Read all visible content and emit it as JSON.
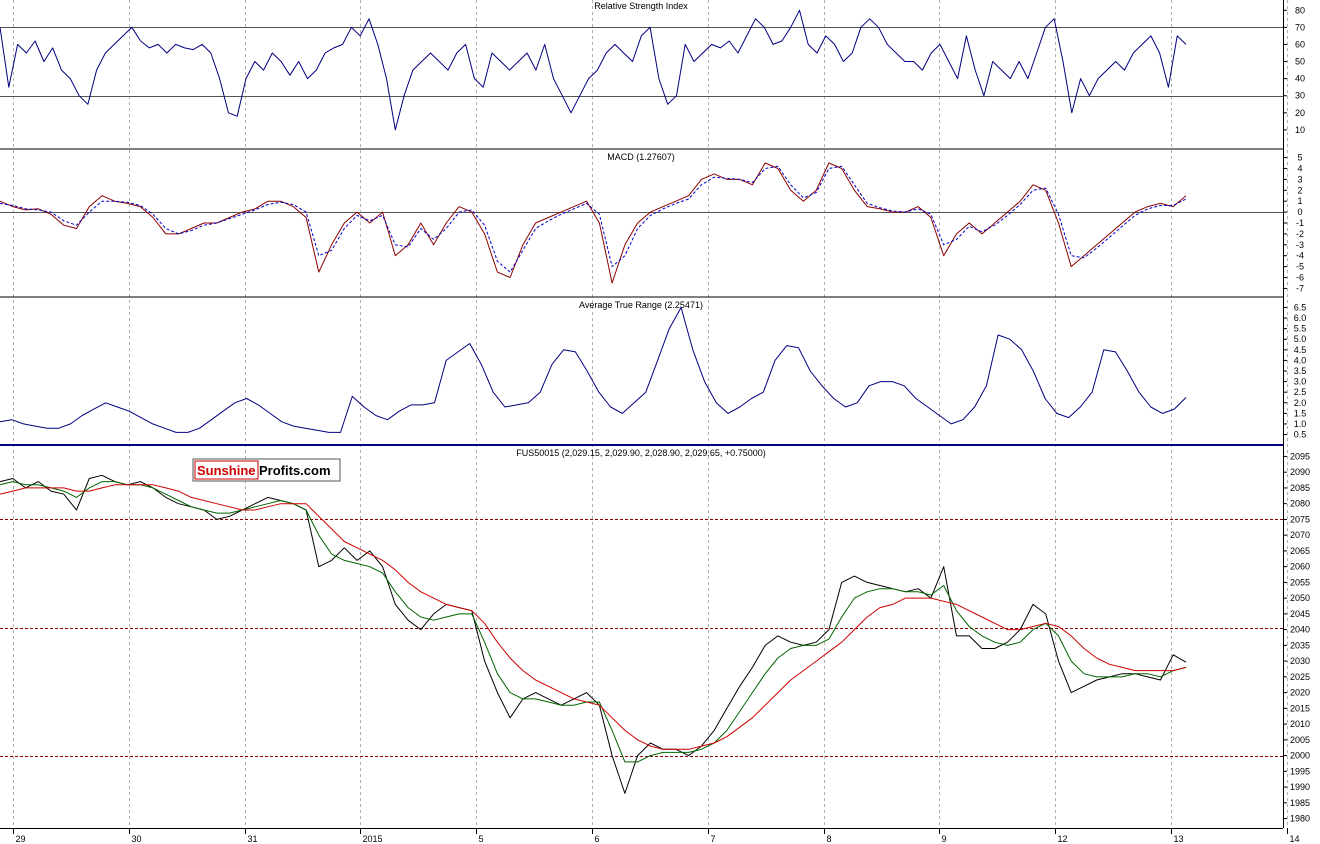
{
  "logo": {
    "part1": "Sunshine",
    "part2": "Profits.com"
  },
  "chart_data": {
    "type": "line",
    "x_labels": [
      "29",
      "30",
      "31",
      "2015",
      "5",
      "6",
      "7",
      "8",
      "9",
      "12",
      "13",
      "14"
    ],
    "panels": [
      {
        "id": "rsi",
        "title": "Relative Strength Index",
        "ylim": [
          0,
          86
        ],
        "yticks": [
          10,
          20,
          30,
          40,
          50,
          60,
          70,
          80
        ],
        "reference_lines": [
          30,
          70
        ],
        "series": [
          {
            "color": "#000080",
            "values": [
              70,
              35,
              60,
              55,
              62,
              50,
              58,
              45,
              40,
              30,
              25,
              45,
              55,
              60,
              65,
              70,
              62,
              58,
              60,
              55,
              60,
              58,
              57,
              60,
              55,
              40,
              20,
              18,
              40,
              50,
              45,
              55,
              50,
              42,
              50,
              40,
              45,
              55,
              58,
              60,
              70,
              65,
              75,
              60,
              40,
              10,
              30,
              45,
              50,
              55,
              50,
              45,
              55,
              60,
              40,
              35,
              55,
              50,
              45,
              50,
              55,
              45,
              60,
              40,
              30,
              20,
              30,
              40,
              45,
              55,
              60,
              55,
              50,
              65,
              70,
              40,
              25,
              30,
              60,
              50,
              55,
              60,
              58,
              62,
              55,
              65,
              75,
              70,
              60,
              62,
              70,
              80,
              60,
              55,
              65,
              60,
              50,
              55,
              70,
              75,
              70,
              60,
              55,
              50,
              50,
              45,
              55,
              60,
              50,
              40,
              65,
              45,
              30,
              50,
              45,
              40,
              50,
              40,
              55,
              70,
              75,
              50,
              20,
              40,
              30,
              40,
              45,
              50,
              45,
              55,
              60,
              65,
              55,
              35,
              65,
              60
            ]
          }
        ]
      },
      {
        "id": "macd",
        "title": "MACD (1.27607)",
        "ylim": [
          -7.6,
          5.6
        ],
        "yticks": [
          -7,
          -6,
          -5,
          -4,
          -3,
          -2,
          -1,
          0,
          1,
          2,
          3,
          4,
          5
        ],
        "reference_lines": [
          0
        ],
        "series": [
          {
            "color": "#8b0000",
            "values": [
              1,
              0.5,
              0.2,
              0.3,
              -0.2,
              -1.2,
              -1.5,
              0.5,
              1.5,
              1,
              0.8,
              0.5,
              -0.5,
              -2,
              -2,
              -1.5,
              -1,
              -1,
              -0.5,
              0,
              0.3,
              1,
              1,
              0.5,
              -0.5,
              -5.5,
              -3,
              -1,
              0,
              -1,
              0,
              -4,
              -3,
              -1,
              -3,
              -1,
              0.5,
              0,
              -2,
              -5.5,
              -6,
              -3,
              -1,
              -0.5,
              0,
              0.5,
              1,
              -1,
              -6.5,
              -3,
              -1,
              0,
              0.5,
              1,
              1.5,
              3,
              3.5,
              3,
              3,
              2.5,
              4.5,
              4,
              2,
              1,
              2,
              4.5,
              4,
              2,
              0.5,
              0.3,
              0,
              0,
              0.5,
              -0.5,
              -4,
              -2,
              -1,
              -2,
              -1,
              0,
              1,
              2.5,
              2,
              -1,
              -5,
              -4,
              -3,
              -2,
              -1,
              0,
              0.5,
              0.8,
              0.5,
              1.5
            ]
          },
          {
            "color": "#0000cc",
            "dashed": true,
            "values": [
              0.8,
              0.6,
              0.3,
              0.2,
              0,
              -0.8,
              -1.2,
              0,
              1,
              1,
              0.9,
              0.6,
              -0.2,
              -1.5,
              -2,
              -1.7,
              -1.2,
              -1,
              -0.6,
              -0.2,
              0.2,
              0.7,
              0.9,
              0.7,
              0,
              -4,
              -3.5,
              -1.5,
              -0.3,
              -0.8,
              -0.3,
              -3,
              -3.2,
              -1.5,
              -2.5,
              -1.5,
              0,
              0.2,
              -1.2,
              -4.5,
              -5.5,
              -3.5,
              -1.5,
              -0.8,
              -0.2,
              0.3,
              0.8,
              -0.2,
              -5,
              -4,
              -1.5,
              -0.3,
              0.3,
              0.8,
              1.2,
              2.5,
              3.2,
              3.1,
              3,
              2.7,
              4,
              4.2,
              2.5,
              1.3,
              1.8,
              4,
              4.2,
              2.5,
              0.8,
              0.4,
              0.1,
              0,
              0.3,
              -0.2,
              -3,
              -2.5,
              -1.3,
              -1.8,
              -1.2,
              -0.3,
              0.7,
              2,
              2.2,
              -0.2,
              -4,
              -4.2,
              -3.3,
              -2.3,
              -1.3,
              -0.3,
              0.3,
              0.6,
              0.6,
              1.2
            ]
          }
        ]
      },
      {
        "id": "atr",
        "title": "Average True Range (2.25471)",
        "ylim": [
          0.1,
          6.9
        ],
        "yticks": [
          0.5,
          1.0,
          1.5,
          2.0,
          2.5,
          3.0,
          3.5,
          4.0,
          4.5,
          5.0,
          5.5,
          6.0,
          6.5
        ],
        "reference_lines": [],
        "series": [
          {
            "color": "#000080",
            "values": [
              1.1,
              1.2,
              1.0,
              0.9,
              0.8,
              0.8,
              1.0,
              1.4,
              1.7,
              2.0,
              1.8,
              1.6,
              1.3,
              1.0,
              0.8,
              0.6,
              0.6,
              0.8,
              1.2,
              1.6,
              2.0,
              2.2,
              1.9,
              1.5,
              1.1,
              0.9,
              0.8,
              0.7,
              0.6,
              0.6,
              2.3,
              1.8,
              1.4,
              1.2,
              1.6,
              1.9,
              1.9,
              2.0,
              4.0,
              4.4,
              4.8,
              3.8,
              2.5,
              1.8,
              1.9,
              2.0,
              2.5,
              3.8,
              4.5,
              4.4,
              3.5,
              2.5,
              1.8,
              1.5,
              2.0,
              2.5,
              4.0,
              5.5,
              6.5,
              4.5,
              3.0,
              2.0,
              1.5,
              1.8,
              2.2,
              2.5,
              4.0,
              4.7,
              4.6,
              3.5,
              2.8,
              2.2,
              1.8,
              2.0,
              2.8,
              3.0,
              3.0,
              2.8,
              2.2,
              1.8,
              1.4,
              1.0,
              1.2,
              1.8,
              2.8,
              5.2,
              5.0,
              4.5,
              3.5,
              2.2,
              1.5,
              1.3,
              1.8,
              2.5,
              4.5,
              4.4,
              3.5,
              2.5,
              1.8,
              1.5,
              1.7,
              2.25
            ]
          }
        ]
      },
      {
        "id": "price",
        "title": "FUS50015 (2,029.15, 2,029.90, 2,028.90, 2,029.65, +0.75000)",
        "ylim": [
          1977,
          2098
        ],
        "yticks": [
          1980,
          1985,
          1990,
          1995,
          2000,
          2005,
          2010,
          2015,
          2020,
          2025,
          2030,
          2035,
          2040,
          2045,
          2050,
          2055,
          2060,
          2065,
          2070,
          2075,
          2080,
          2085,
          2090,
          2095
        ],
        "reference_lines": [
          2000,
          2040.5,
          2075
        ],
        "series": [
          {
            "name": "",
            "color": "#000000",
            "values": [
              2087,
              2088,
              2085,
              2087,
              2084,
              2083,
              2078,
              2088,
              2089,
              2087,
              2086,
              2087,
              2085,
              2082,
              2080,
              2079,
              2078,
              2075,
              2076,
              2078,
              2080,
              2082,
              2081,
              2080,
              2078,
              2060,
              2062,
              2066,
              2062,
              2065,
              2060,
              2048,
              2043,
              2040,
              2045,
              2048,
              2047,
              2046,
              2030,
              2020,
              2012,
              2018,
              2020,
              2018,
              2016,
              2018,
              2020,
              2016,
              2000,
              1988,
              2000,
              2004,
              2002,
              2002,
              2000,
              2003,
              2008,
              2015,
              2022,
              2028,
              2035,
              2038,
              2036,
              2035,
              2036,
              2040,
              2055,
              2057,
              2055,
              2054,
              2053,
              2052,
              2053,
              2050,
              2060,
              2038,
              2038,
              2034,
              2034,
              2036,
              2040,
              2048,
              2045,
              2030,
              2020,
              2022,
              2024,
              2025,
              2026,
              2026,
              2025,
              2024,
              2032,
              2029.65
            ]
          },
          {
            "name": "",
            "color": "#006400",
            "values": [
              2086,
              2087,
              2086,
              2086,
              2085,
              2084,
              2082,
              2085,
              2087,
              2087,
              2086,
              2086,
              2085,
              2083,
              2081,
              2079,
              2078,
              2077,
              2077,
              2078,
              2079,
              2080,
              2081,
              2080,
              2078,
              2070,
              2064,
              2062,
              2061,
              2060,
              2058,
              2052,
              2047,
              2044,
              2043,
              2044,
              2045,
              2045,
              2036,
              2026,
              2020,
              2018,
              2018,
              2017,
              2016,
              2016,
              2017,
              2017,
              2008,
              1998,
              1998,
              2000,
              2001,
              2001,
              2001,
              2002,
              2004,
              2008,
              2014,
              2020,
              2026,
              2031,
              2034,
              2035,
              2035,
              2037,
              2044,
              2050,
              2052,
              2053,
              2053,
              2052,
              2052,
              2051,
              2054,
              2046,
              2041,
              2038,
              2036,
              2035,
              2036,
              2040,
              2042,
              2038,
              2030,
              2026,
              2025,
              2025,
              2025,
              2026,
              2026,
              2025,
              2027,
              2028
            ]
          },
          {
            "name": "",
            "color": "#cc0000",
            "values": [
              2083,
              2084,
              2085,
              2085,
              2085,
              2085,
              2084,
              2084,
              2085,
              2086,
              2086,
              2086,
              2086,
              2085,
              2084,
              2082,
              2081,
              2080,
              2079,
              2078,
              2078,
              2079,
              2080,
              2080,
              2080,
              2076,
              2072,
              2068,
              2066,
              2064,
              2062,
              2059,
              2055,
              2052,
              2050,
              2048,
              2047,
              2046,
              2042,
              2036,
              2031,
              2027,
              2024,
              2022,
              2020,
              2018,
              2017,
              2016,
              2012,
              2008,
              2005,
              2003,
              2002,
              2002,
              2002,
              2003,
              2004,
              2006,
              2009,
              2012,
              2016,
              2020,
              2024,
              2027,
              2030,
              2033,
              2036,
              2040,
              2044,
              2047,
              2048,
              2050,
              2050,
              2050,
              2049,
              2048,
              2046,
              2044,
              2042,
              2040,
              2040,
              2041,
              2042,
              2041,
              2038,
              2034,
              2031,
              2029,
              2028,
              2027,
              2027,
              2027,
              2027,
              2028
            ]
          }
        ]
      }
    ]
  }
}
